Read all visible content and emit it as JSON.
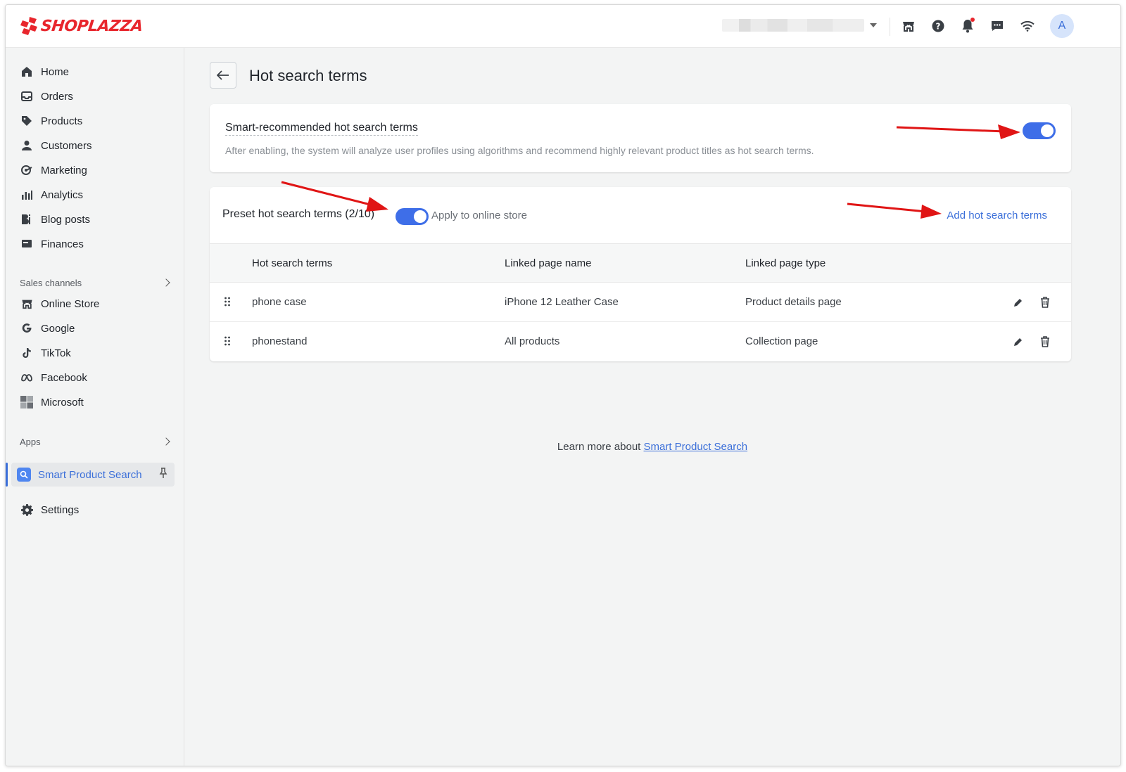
{
  "brand": {
    "name": "SHOPLAZZA",
    "color": "#e8262d"
  },
  "accent_color": "#3e6ee8",
  "header": {
    "store_selector": {
      "value": "",
      "icon": "chevron-down-icon"
    },
    "icons": [
      "online-store-icon",
      "help-icon",
      "notification-bell-icon",
      "message-icon",
      "wifi-icon"
    ],
    "avatar_initial": "A"
  },
  "sidebar": {
    "items": [
      {
        "label": "Home",
        "icon": "home-icon"
      },
      {
        "label": "Orders",
        "icon": "inbox-icon"
      },
      {
        "label": "Products",
        "icon": "tag-icon"
      },
      {
        "label": "Customers",
        "icon": "person-icon"
      },
      {
        "label": "Marketing",
        "icon": "target-icon"
      },
      {
        "label": "Analytics",
        "icon": "bar-chart-icon"
      },
      {
        "label": "Blog posts",
        "icon": "blog-icon"
      },
      {
        "label": "Finances",
        "icon": "card-icon"
      }
    ],
    "sales_channels_label": "Sales channels",
    "channels": [
      {
        "label": "Online Store",
        "icon": "store-icon"
      },
      {
        "label": "Google",
        "icon": "google-icon"
      },
      {
        "label": "TikTok",
        "icon": "tiktok-icon"
      },
      {
        "label": "Facebook",
        "icon": "meta-icon"
      },
      {
        "label": "Microsoft",
        "icon": "microsoft-icon"
      }
    ],
    "apps_label": "Apps",
    "active_app": {
      "label": "Smart Product Search",
      "icon": "smart-search-app-icon"
    },
    "settings_label": "Settings"
  },
  "page": {
    "title": "Hot search terms",
    "smart_card": {
      "title": "Smart-recommended hot search terms",
      "description": "After enabling, the system will analyze user profiles using algorithms and recommend highly relevant product titles as hot search terms.",
      "enabled": true
    },
    "preset_card": {
      "title": "Preset hot search terms (2/10)",
      "apply_label": "Apply to online store",
      "apply_enabled": true,
      "add_link": "Add hot search terms",
      "columns": [
        "Hot search terms",
        "Linked page name",
        "Linked page type"
      ],
      "rows": [
        {
          "term": "phone case",
          "page_name": "iPhone 12 Leather Case",
          "page_type": "Product details page"
        },
        {
          "term": "phonestand",
          "page_name": "All products",
          "page_type": "Collection page"
        }
      ]
    },
    "learn_more": {
      "prefix": "Learn more about ",
      "link": "Smart Product Search"
    }
  }
}
